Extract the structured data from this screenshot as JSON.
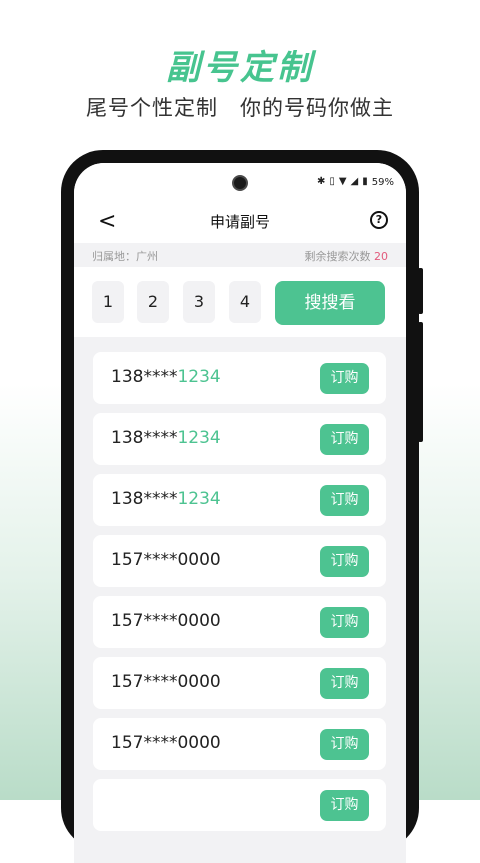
{
  "promo": {
    "headline": "副号定制",
    "subline": "尾号个性定制　你的号码你做主"
  },
  "status_bar": {
    "bluetooth_icon": "✱",
    "vibrate_icon": "▯",
    "wifi_icon": "▼",
    "signal_icon": "◢",
    "battery_icon": "▮",
    "battery": "59%"
  },
  "nav": {
    "back_icon": "<",
    "title": "申请副号",
    "help_icon": "?"
  },
  "info": {
    "location": "归属地：广州",
    "remaining_label": "剩余搜索次数",
    "remaining_count": "20"
  },
  "search": {
    "digits": [
      "1",
      "2",
      "3",
      "4"
    ],
    "button": "搜搜看"
  },
  "numbers": [
    {
      "prefix": "138****",
      "tail": "1234",
      "buy": "订购"
    },
    {
      "prefix": "138****",
      "tail": "1234",
      "buy": "订购"
    },
    {
      "prefix": "138****",
      "tail": "1234",
      "buy": "订购"
    },
    {
      "prefix": "157****0000",
      "tail": "",
      "buy": "订购"
    },
    {
      "prefix": "157****0000",
      "tail": "",
      "buy": "订购"
    },
    {
      "prefix": "157****0000",
      "tail": "",
      "buy": "订购"
    },
    {
      "prefix": "157****0000",
      "tail": "",
      "buy": "订购"
    },
    {
      "prefix": "",
      "tail": "",
      "buy": "订购"
    }
  ],
  "colors": {
    "accent": "#4dc391",
    "highlight_count": "#e25b7c"
  }
}
